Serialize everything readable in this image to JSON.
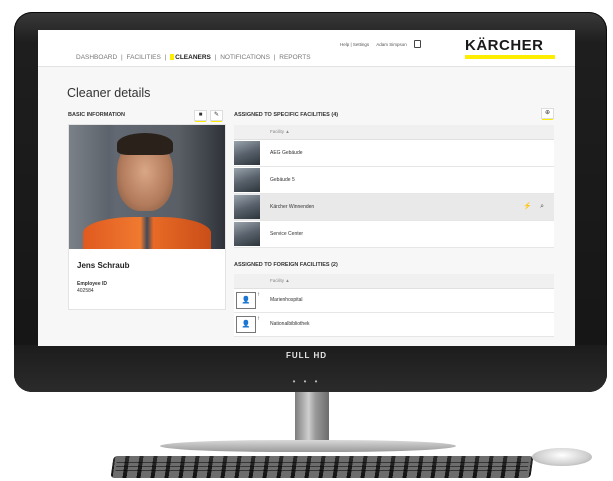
{
  "device": {
    "bezel_label": "FULL HD",
    "power_dots": "• • •"
  },
  "header": {
    "nav": [
      {
        "label": "DASHBOARD",
        "active": false
      },
      {
        "label": "FACILITIES",
        "active": false
      },
      {
        "label": "CLEANERS",
        "active": true
      },
      {
        "label": "NOTIFICATIONS",
        "active": false
      },
      {
        "label": "REPORTS",
        "active": false
      }
    ],
    "help_settings": "Help | Settings",
    "user_name": "Adam Simpson",
    "logo": "KÄRCHER",
    "accent_color": "#ffed00"
  },
  "page": {
    "title": "Cleaner details"
  },
  "basic": {
    "section_title": "BASIC INFORMATION",
    "name": "Jens Schraub",
    "id_label": "Employee ID",
    "id_value": "402584"
  },
  "specific": {
    "section_title": "ASSIGNED TO SPECIFIC FACILITIES (4)",
    "column": "Facility ▲",
    "rows": [
      {
        "name": "AEG Gebäude"
      },
      {
        "name": "Gebäude 5"
      },
      {
        "name": "Kärcher Winnenden"
      },
      {
        "name": "Service Center"
      }
    ]
  },
  "foreign": {
    "section_title": "ASSIGNED TO FOREIGN FACILITIES (2)",
    "column": "Facility ▲",
    "rows": [
      {
        "name": "Marienhospital"
      },
      {
        "name": "Nationalbibliothek"
      }
    ]
  }
}
